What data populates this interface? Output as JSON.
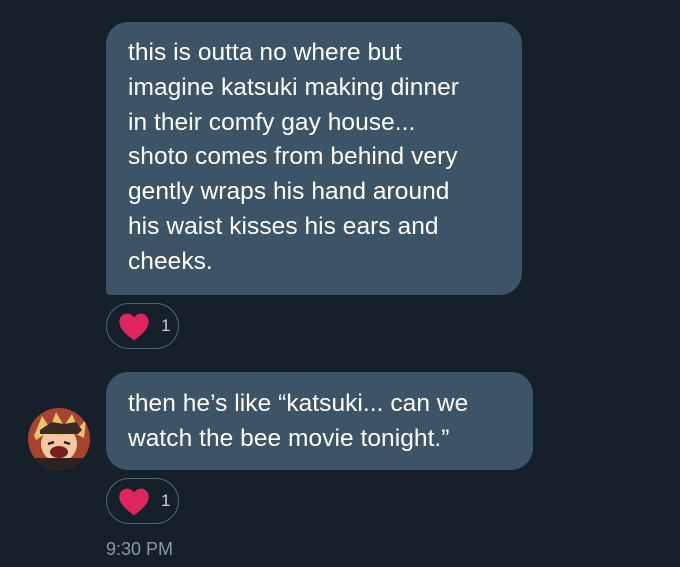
{
  "messages": [
    {
      "text": "this is outta no where but\nimagine katsuki making dinner\nin their comfy gay house...\nshoto comes from behind very\ngently wraps his hand around\nhis waist kisses his ears and\ncheeks.",
      "reaction": {
        "icon": "heart-icon",
        "count": "1"
      }
    },
    {
      "text": "then he’s like “katsuki... can we\nwatch the bee movie tonight.”",
      "reaction": {
        "icon": "heart-icon",
        "count": "1"
      },
      "sender_avatar": "avatar"
    }
  ],
  "timestamp": "9:30 PM",
  "colors": {
    "background": "#15202b",
    "bubble": "#3d5466",
    "heart": "#e0245e",
    "text": "#ffffff",
    "meta": "#8b98a5"
  }
}
